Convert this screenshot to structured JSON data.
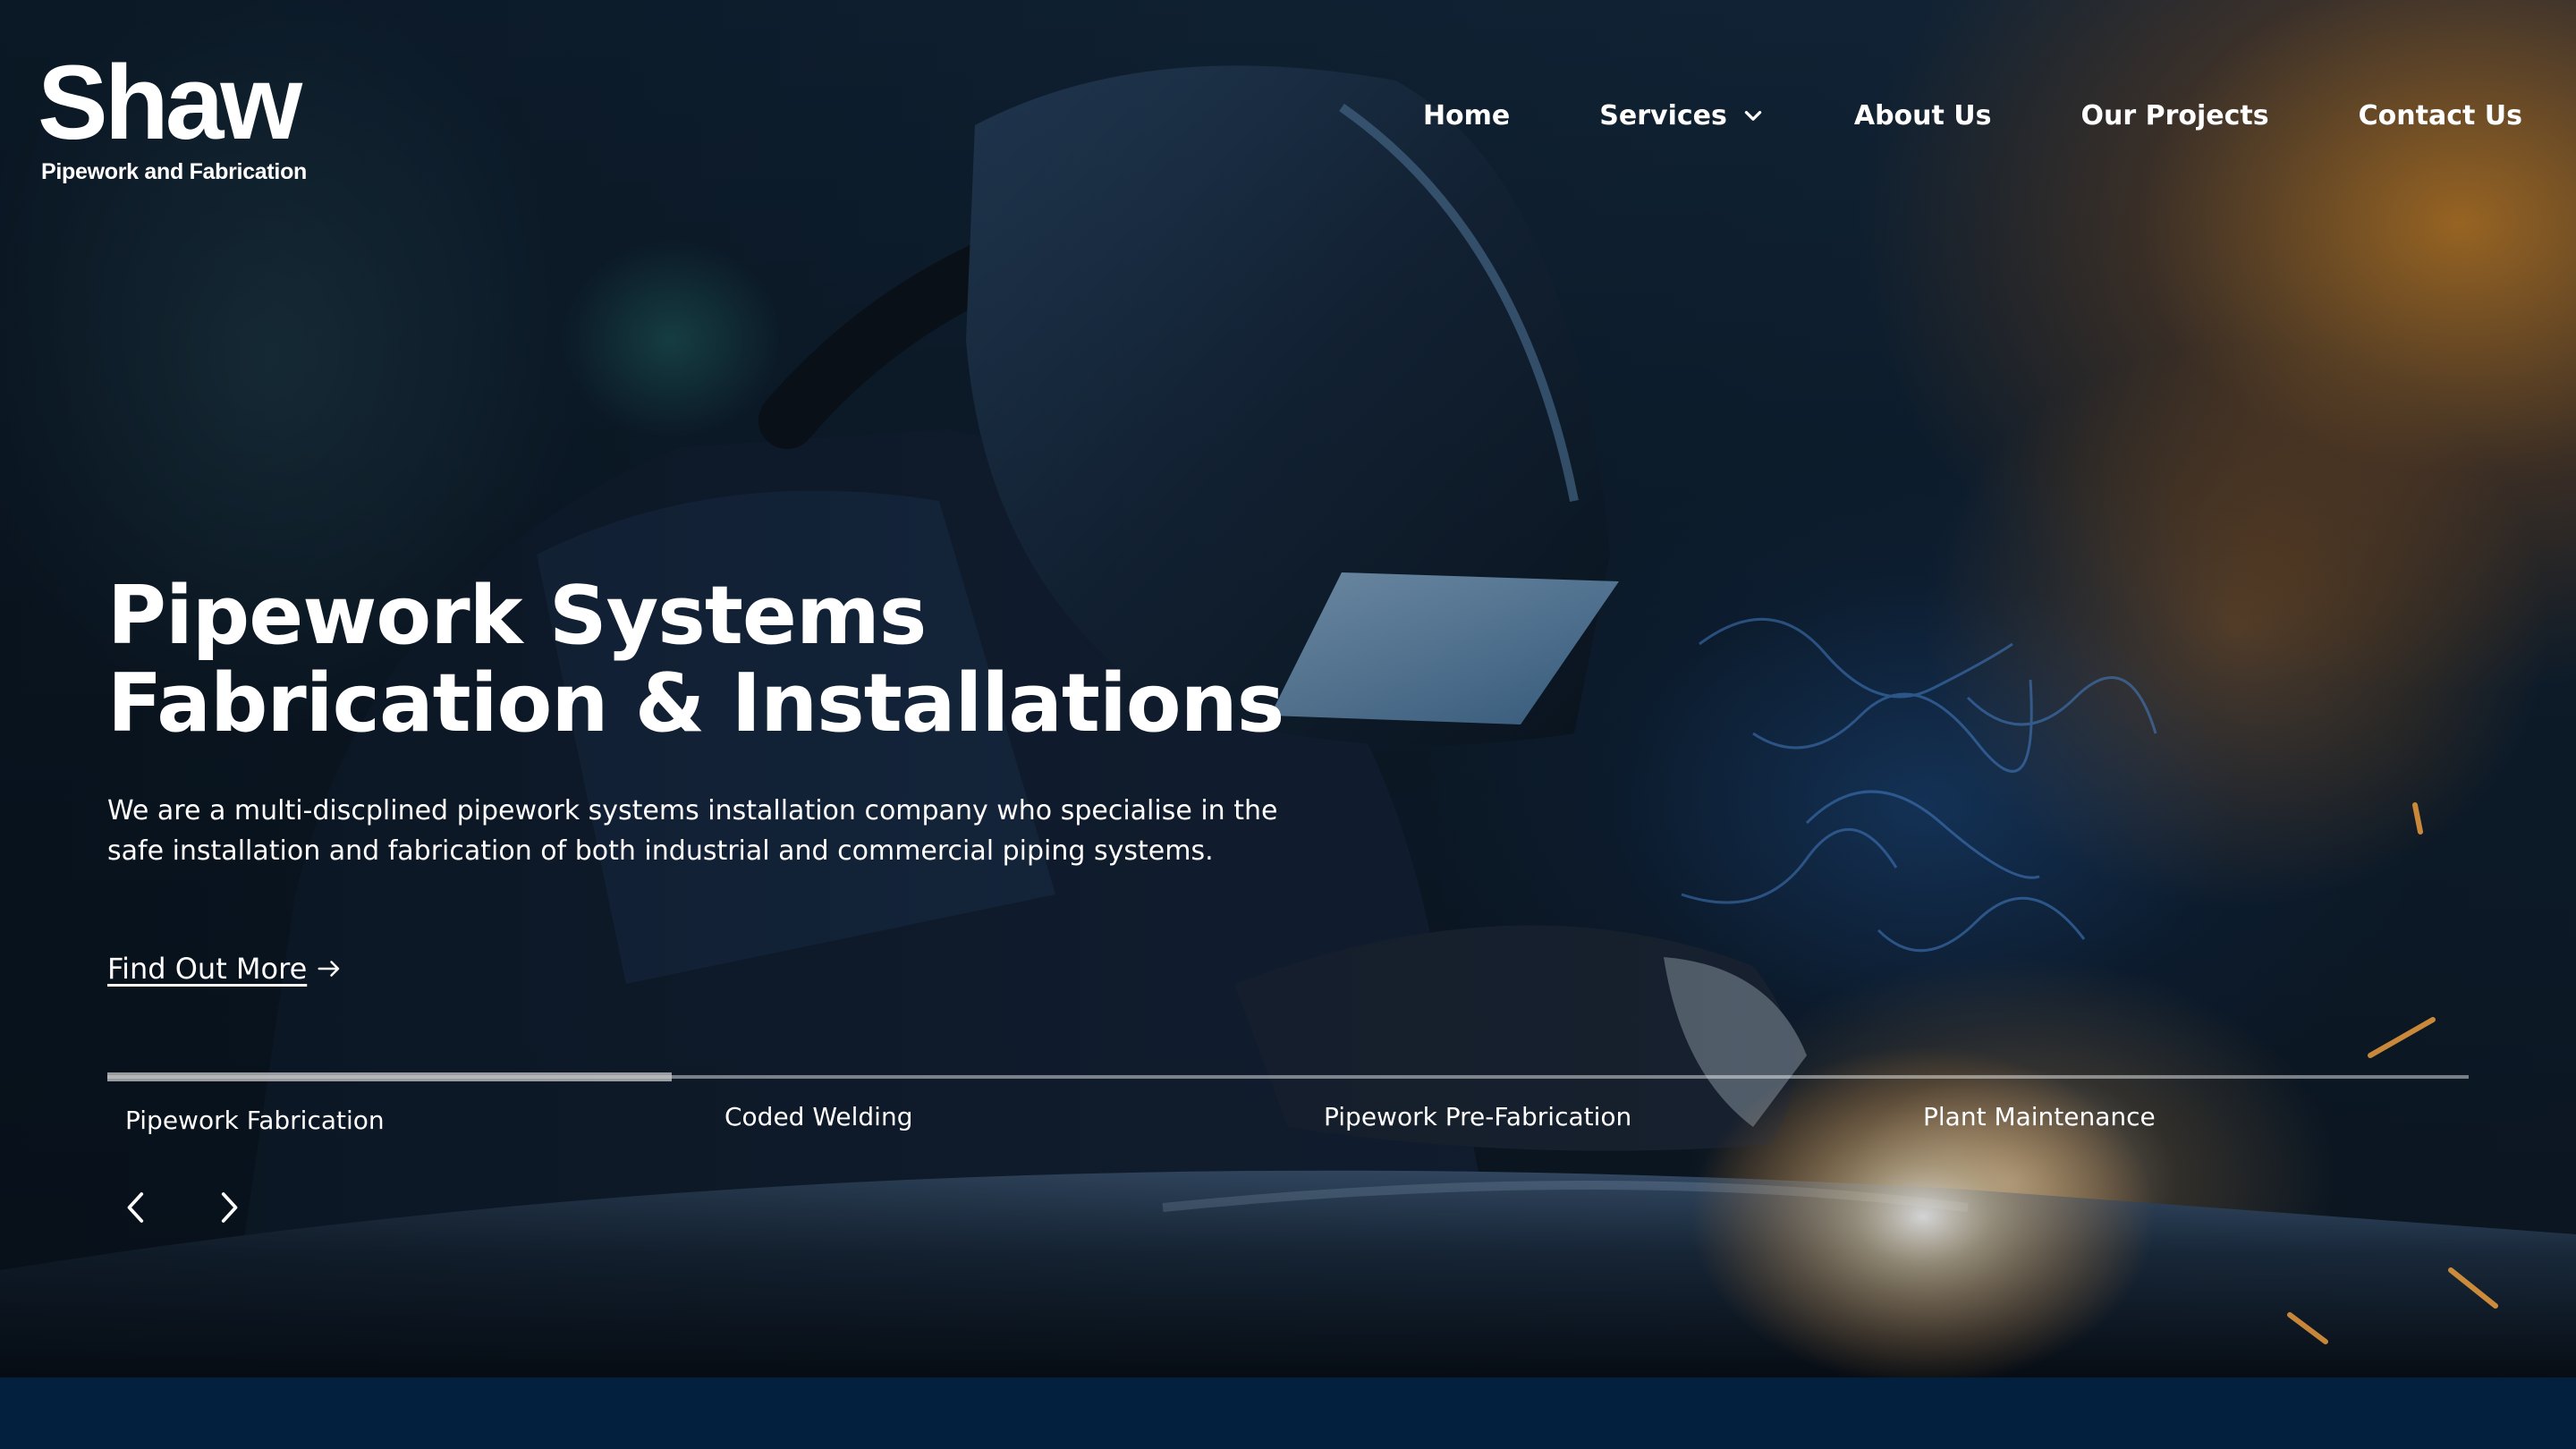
{
  "brand": {
    "name": "Shaw",
    "tagline": "Pipework and Fabrication"
  },
  "nav": {
    "items": [
      {
        "label": "Home"
      },
      {
        "label": "Services",
        "icon": "chevron-down-icon"
      },
      {
        "label": "About Us"
      },
      {
        "label": "Our Projects"
      },
      {
        "label": "Contact Us"
      }
    ]
  },
  "hero": {
    "headline_line1": "Pipework Systems",
    "headline_line2": "Fabrication & Installations",
    "description": "We are a multi-discplined pipework systems installation company who specialise in the safe installation and fabrication of both industrial and commercial piping systems.",
    "cta_label": "Find Out More",
    "cta_icon": "arrow-right-icon"
  },
  "slider": {
    "tabs": [
      {
        "label": "Pipework Fabrication",
        "active": true
      },
      {
        "label": "Coded Welding",
        "active": false
      },
      {
        "label": "Pipework Pre-Fabrication",
        "active": false
      },
      {
        "label": "Plant Maintenance",
        "active": false
      }
    ],
    "progress_fraction": 0.239,
    "prev_icon": "chevron-left-icon",
    "next_icon": "chevron-right-icon"
  },
  "colors": {
    "text": "#ffffff",
    "bottom_band": "#03213f",
    "accent_orange": "#d4821e",
    "spark_blue": "#3a7bd5"
  }
}
